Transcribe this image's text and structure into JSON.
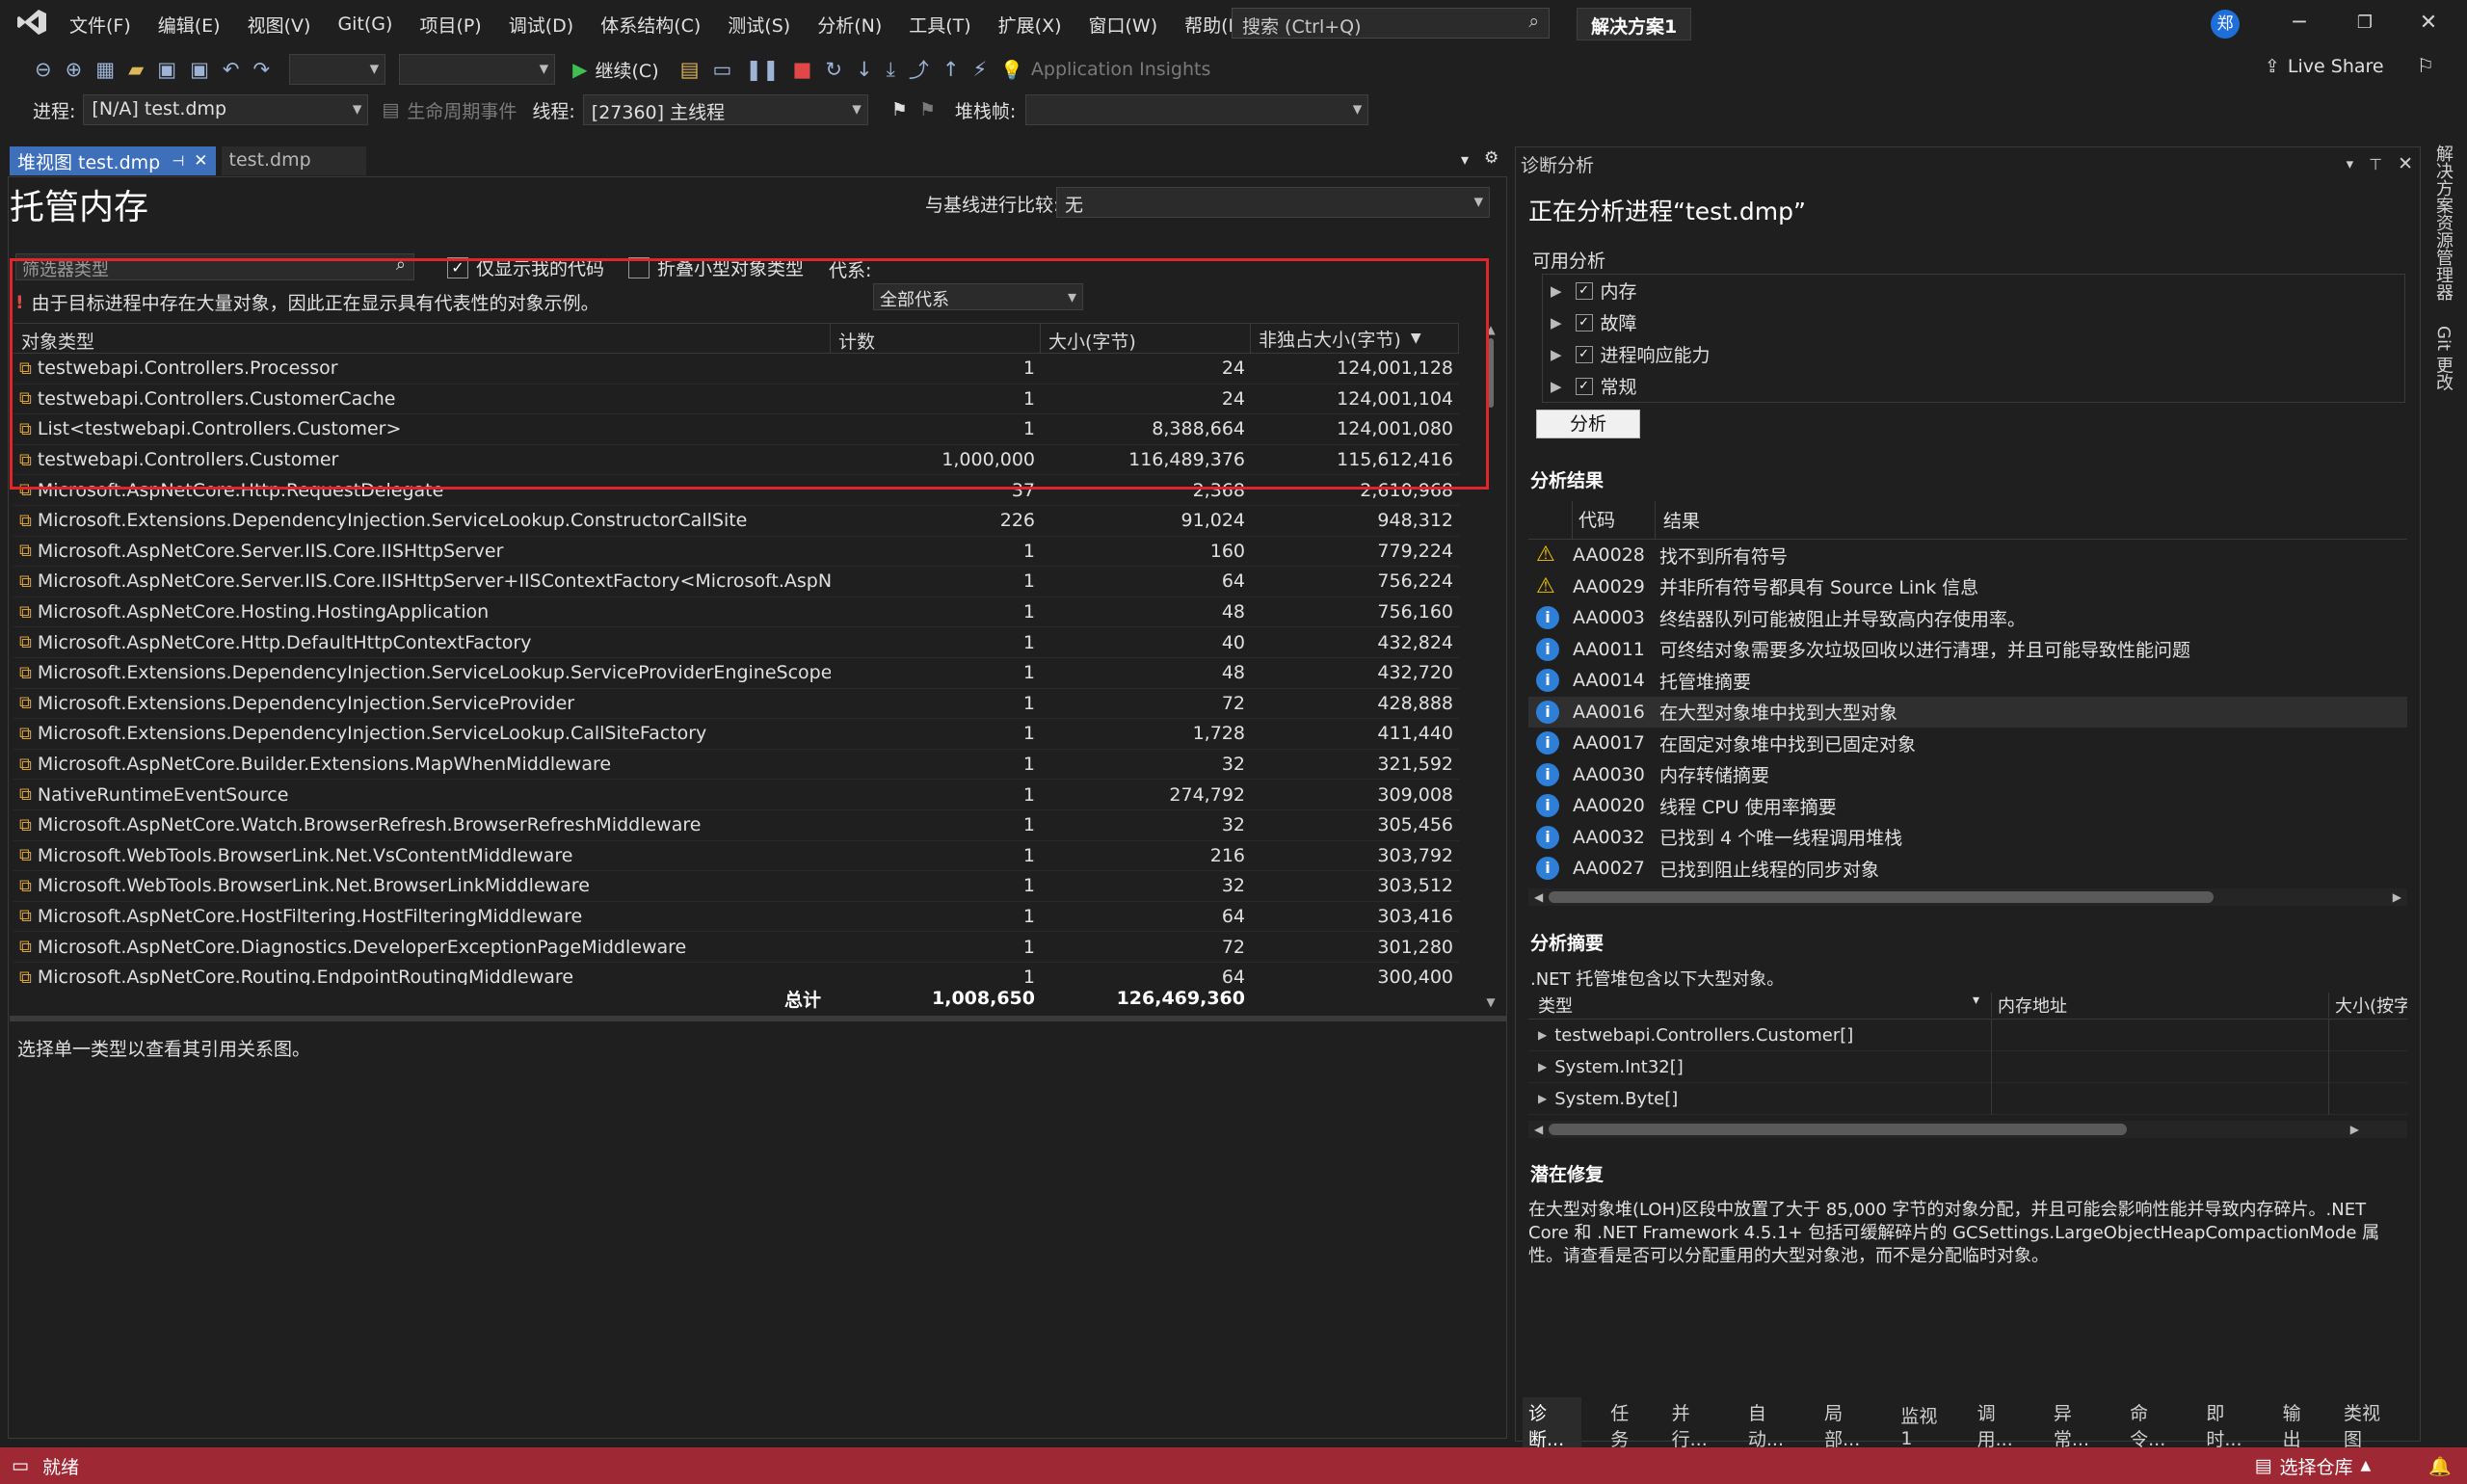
{
  "menu": [
    "文件(F)",
    "编辑(E)",
    "视图(V)",
    "Git(G)",
    "项目(P)",
    "调试(D)",
    "体系结构(C)",
    "测试(S)",
    "分析(N)",
    "工具(T)",
    "扩展(X)",
    "窗口(W)",
    "帮助(H)"
  ],
  "search_placeholder": "搜索 (Ctrl+Q)",
  "solution_name": "解决方案1",
  "avatar_initial": "郑",
  "toolbar": {
    "continue_label": "继续(C)",
    "app_insights": "Application Insights",
    "live_share": "Live Share"
  },
  "debugbar": {
    "process_label": "进程:",
    "process_value": "[N/A] test.dmp",
    "lifecycle_label": "生命周期事件",
    "thread_label": "线程:",
    "thread_value": "[27360] 主线程",
    "stackframe_label": "堆栈帧:"
  },
  "doc_tabs": [
    {
      "label": "堆视图 test.dmp",
      "active": true
    },
    {
      "label": "test.dmp",
      "active": false
    }
  ],
  "managed": {
    "title": "托管内存",
    "baseline_label": "与基线进行比较:",
    "baseline_value": "无",
    "filter_placeholder": "筛选器类型",
    "only_my_code": "仅显示我的代码",
    "collapse_small": "折叠小型对象类型",
    "generation_label": "代系:",
    "generation_value": "全部代系",
    "warning": "由于目标进程中存在大量对象，因此正在显示具有代表性的对象示例。",
    "columns": [
      "对象类型",
      "计数",
      "大小(字节)",
      "非独占大小(字节)"
    ],
    "rows": [
      [
        "testwebapi.Controllers.Processor",
        "1",
        "24",
        "124,001,128"
      ],
      [
        "testwebapi.Controllers.CustomerCache",
        "1",
        "24",
        "124,001,104"
      ],
      [
        "List<testwebapi.Controllers.Customer>",
        "1",
        "8,388,664",
        "124,001,080"
      ],
      [
        "testwebapi.Controllers.Customer",
        "1,000,000",
        "116,489,376",
        "115,612,416"
      ],
      [
        "Microsoft.AspNetCore.Http.RequestDelegate",
        "37",
        "2,368",
        "2,610,968"
      ],
      [
        "Microsoft.Extensions.DependencyInjection.ServiceLookup.ConstructorCallSite",
        "226",
        "91,024",
        "948,312"
      ],
      [
        "Microsoft.AspNetCore.Server.IIS.Core.IISHttpServer",
        "1",
        "160",
        "779,224"
      ],
      [
        "Microsoft.AspNetCore.Server.IIS.Core.IISHttpServer+IISContextFactory<Microsoft.AspNetCore.",
        "1",
        "64",
        "756,224"
      ],
      [
        "Microsoft.AspNetCore.Hosting.HostingApplication",
        "1",
        "48",
        "756,160"
      ],
      [
        "Microsoft.AspNetCore.Http.DefaultHttpContextFactory",
        "1",
        "40",
        "432,824"
      ],
      [
        "Microsoft.Extensions.DependencyInjection.ServiceLookup.ServiceProviderEngineScope",
        "1",
        "48",
        "432,720"
      ],
      [
        "Microsoft.Extensions.DependencyInjection.ServiceProvider",
        "1",
        "72",
        "428,888"
      ],
      [
        "Microsoft.Extensions.DependencyInjection.ServiceLookup.CallSiteFactory",
        "1",
        "1,728",
        "411,440"
      ],
      [
        "Microsoft.AspNetCore.Builder.Extensions.MapWhenMiddleware",
        "1",
        "32",
        "321,592"
      ],
      [
        "NativeRuntimeEventSource",
        "1",
        "274,792",
        "309,008"
      ],
      [
        "Microsoft.AspNetCore.Watch.BrowserRefresh.BrowserRefreshMiddleware",
        "1",
        "32",
        "305,456"
      ],
      [
        "Microsoft.WebTools.BrowserLink.Net.VsContentMiddleware",
        "1",
        "216",
        "303,792"
      ],
      [
        "Microsoft.WebTools.BrowserLink.Net.BrowserLinkMiddleware",
        "1",
        "32",
        "303,512"
      ],
      [
        "Microsoft.AspNetCore.HostFiltering.HostFilteringMiddleware",
        "1",
        "64",
        "303,416"
      ],
      [
        "Microsoft.AspNetCore.Diagnostics.DeveloperExceptionPageMiddleware",
        "1",
        "72",
        "301,280"
      ],
      [
        "Microsoft.AspNetCore.Routing.EndpointRoutingMiddleware",
        "1",
        "64",
        "300,400"
      ]
    ],
    "total_label": "总计",
    "total_count": "1,008,650",
    "total_size": "126,469,360",
    "hint": "选择单一类型以查看其引用关系图。"
  },
  "diag": {
    "header": "诊断分析",
    "title": "正在分析进程“test.dmp”",
    "available_label": "可用分析",
    "available": [
      "内存",
      "故障",
      "进程响应能力",
      "常规"
    ],
    "analyze_button": "分析",
    "results_label": "分析结果",
    "results_columns": [
      "代码",
      "结果"
    ],
    "results": [
      {
        "icon": "warning",
        "code": "AA0028",
        "text": "找不到所有符号"
      },
      {
        "icon": "warning",
        "code": "AA0029",
        "text": "并非所有符号都具有 Source Link 信息"
      },
      {
        "icon": "info",
        "code": "AA0003",
        "text": "终结器队列可能被阻止并导致高内存使用率。"
      },
      {
        "icon": "info",
        "code": "AA0011",
        "text": "可终结对象需要多次垃圾回收以进行清理，并且可能导致性能问题"
      },
      {
        "icon": "info",
        "code": "AA0014",
        "text": "托管堆摘要"
      },
      {
        "icon": "info",
        "code": "AA0016",
        "text": "在大型对象堆中找到大型对象"
      },
      {
        "icon": "info",
        "code": "AA0017",
        "text": "在固定对象堆中找到已固定对象"
      },
      {
        "icon": "info",
        "code": "AA0030",
        "text": "内存转储摘要"
      },
      {
        "icon": "info",
        "code": "AA0020",
        "text": "线程 CPU 使用率摘要"
      },
      {
        "icon": "info",
        "code": "AA0032",
        "text": "已找到 4 个唯一线程调用堆栈"
      },
      {
        "icon": "info",
        "code": "AA0027",
        "text": "已找到阻止线程的同步对象"
      }
    ],
    "summary_label": "分析摘要",
    "summary_text": ".NET 托管堆包含以下大型对象。",
    "summary_columns": [
      "类型",
      "内存地址",
      "大小(按字"
    ],
    "summary_rows": [
      "testwebapi.Controllers.Customer[]",
      "System.Int32[]",
      "System.Byte[]"
    ],
    "fix_label": "潜在修复",
    "fix_text": "在大型对象堆(LOH)区段中放置了大于 85,000 字节的对象分配，并且可能会影响性能并导致内存碎片。.NET Core 和 .NET Framework 4.5.1+ 包括可缓解碎片的 GCSettings.LargeObjectHeapCompactionMode 属性。请查看是否可以分配重用的大型对象池，而不是分配临时对象。"
  },
  "bottom_tabs": [
    "诊断...",
    "任务",
    "并行...",
    "自动...",
    "局部...",
    "监视 1",
    "调用...",
    "异常...",
    "命令...",
    "即时...",
    "输出",
    "类视图"
  ],
  "side_tabs": [
    "解决方案资源管理器",
    "Git 更改"
  ],
  "status": {
    "ready": "就绪",
    "repo": "选择仓库"
  }
}
